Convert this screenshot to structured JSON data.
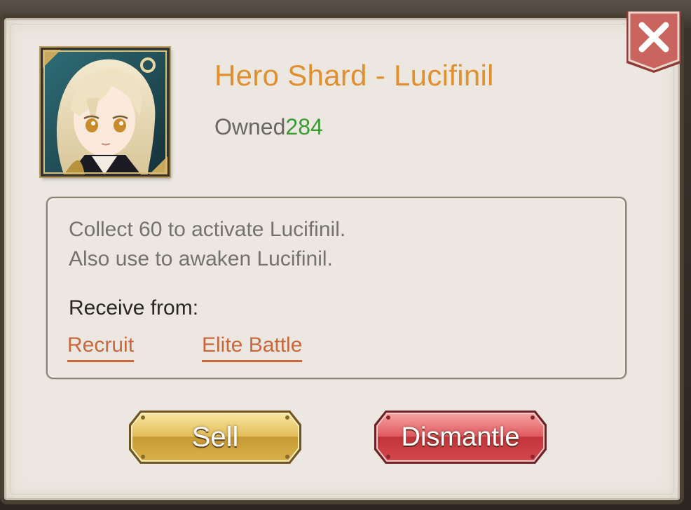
{
  "item": {
    "title": "Hero Shard - Lucifinil",
    "owned_label": "Owned",
    "owned_count": "284",
    "portrait_icon": "hero-portrait-lucifinil"
  },
  "description": {
    "line1": "Collect 60 to activate Lucifinil.",
    "line2": "Also use to awaken Lucifinil.",
    "receive_label": "Receive from:",
    "sources": [
      "Recruit",
      "Elite Battle"
    ]
  },
  "buttons": {
    "sell": "Sell",
    "dismantle": "Dismantle"
  },
  "close_icon": "close-x-icon",
  "colors": {
    "title": "#e0902e",
    "owned_count": "#3c9a34",
    "link": "#c8683c",
    "sell_button": "#e2bd5a",
    "dismantle_button": "#d8474d",
    "close_ribbon": "#c9645e"
  }
}
